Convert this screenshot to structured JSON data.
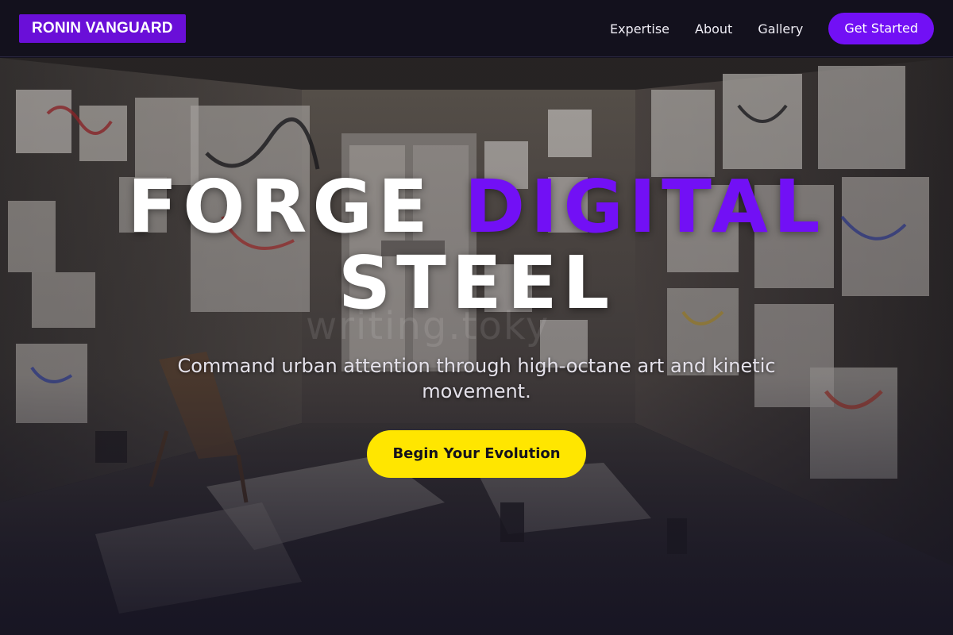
{
  "brand": {
    "name": "RONIN VANGUARD"
  },
  "nav": {
    "links": [
      {
        "label": "Expertise"
      },
      {
        "label": "About"
      },
      {
        "label": "Gallery"
      }
    ],
    "cta_label": "Get Started"
  },
  "hero": {
    "headline_part1": "FORGE",
    "headline_accent": "DIGITAL",
    "headline_part2": "STEEL",
    "subtitle": "Command urban attention through high-octane art and kinetic movement.",
    "cta_label": "Begin Your Evolution",
    "background": "art studio room with drawings covering walls and floor",
    "watermark": "writing.toky"
  },
  "colors": {
    "accent": "#7210f5",
    "logo_bg": "#6a0fd8",
    "cta_yellow": "#ffe600",
    "page_bg": "#15131f"
  }
}
